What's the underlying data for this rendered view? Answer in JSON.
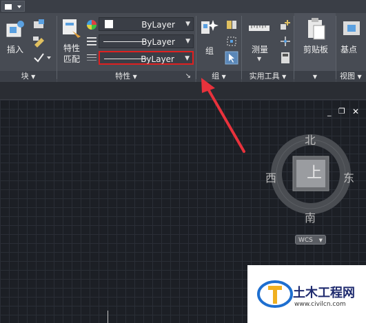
{
  "ribbon": {
    "block": {
      "insert_label": "插入",
      "panel_label": "块"
    },
    "properties": {
      "match_label_line1": "特性",
      "match_label_line2": "匹配",
      "color_value": "ByLayer",
      "linetype_value": "ByLayer",
      "lineweight_value": "ByLayer",
      "panel_label": "特性"
    },
    "group": {
      "group_label": "组",
      "panel_label": "组"
    },
    "utilities": {
      "measure_label": "测量",
      "panel_label": "实用工具"
    },
    "clipboard": {
      "clipboard_label": "剪贴板"
    },
    "view": {
      "base_label": "基点",
      "panel_label": "视图"
    }
  },
  "viewcube": {
    "north": "北",
    "south": "南",
    "east": "东",
    "west": "西",
    "face": "上",
    "ucs": "WCS"
  },
  "watermark": {
    "title": "土木工程网",
    "url": "www.civilcn.com"
  },
  "colors": {
    "highlight_border": "#e02020",
    "annotation_arrow": "#e8323c"
  }
}
